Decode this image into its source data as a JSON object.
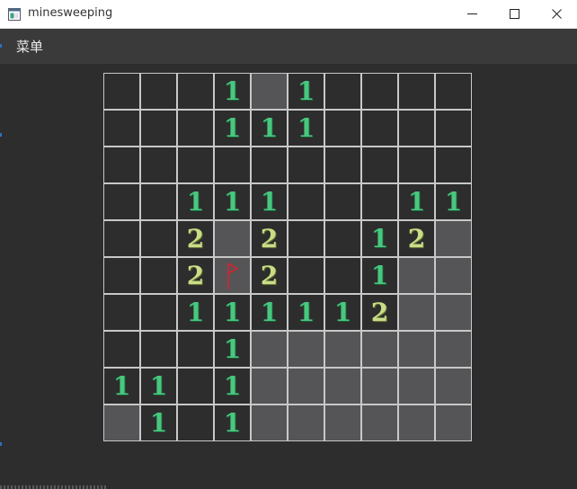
{
  "window": {
    "title": "minesweeping",
    "icon": "app-window-icon",
    "controls": [
      "minimize-icon",
      "maximize-icon",
      "close-icon"
    ]
  },
  "menu": {
    "label": "菜单"
  },
  "board": {
    "rows": 10,
    "cols": 10,
    "legend": {
      "": "revealed-empty",
      "H": "unrevealed",
      "F": "flagged"
    },
    "grid": [
      [
        "",
        "",
        "",
        "1",
        "H",
        "1",
        "",
        "",
        "",
        ""
      ],
      [
        "",
        "",
        "",
        "1",
        "1",
        "1",
        "",
        "",
        "",
        ""
      ],
      [
        "",
        "",
        "",
        "",
        "",
        "",
        "",
        "",
        "",
        ""
      ],
      [
        "",
        "",
        "1",
        "1",
        "1",
        "",
        "",
        "",
        "1",
        "1"
      ],
      [
        "",
        "",
        "2",
        "H",
        "2",
        "",
        "",
        "1",
        "2",
        "H"
      ],
      [
        "",
        "",
        "2",
        "F",
        "2",
        "",
        "",
        "1",
        "H",
        "H"
      ],
      [
        "",
        "",
        "1",
        "1",
        "1",
        "1",
        "1",
        "2",
        "H",
        "H"
      ],
      [
        "",
        "",
        "",
        "1",
        "H",
        "H",
        "H",
        "H",
        "H",
        "H"
      ],
      [
        "1",
        "1",
        "",
        "1",
        "H",
        "H",
        "H",
        "H",
        "H",
        "H"
      ],
      [
        "H",
        "1",
        "",
        "1",
        "H",
        "H",
        "H",
        "H",
        "H",
        "H"
      ]
    ]
  },
  "colors": {
    "background": "#2d2d2d",
    "menubar": "#3a3a3a",
    "unrevealed": "#555557",
    "grid_line": "#c8c8c8",
    "number_1": "#48c77f",
    "number_2": "#c8dd86",
    "flag": "#e0202a"
  }
}
